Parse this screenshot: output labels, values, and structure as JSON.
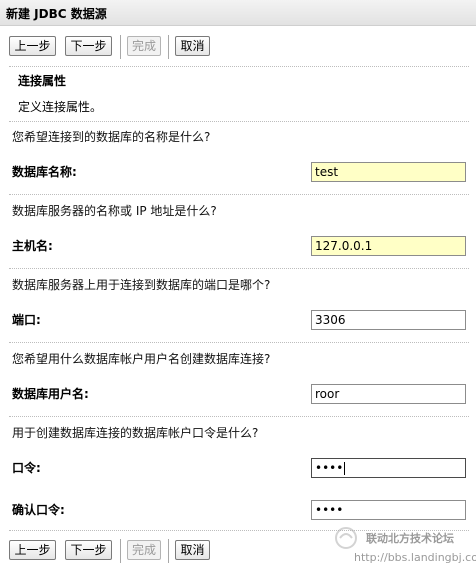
{
  "dialog": {
    "title": "新建 JDBC 数据源"
  },
  "toolbar": {
    "prev_label": "上一步",
    "next_label": "下一步",
    "finish_label": "完成",
    "cancel_label": "取消"
  },
  "section": {
    "heading": "连接属性",
    "description": "定义连接属性。"
  },
  "form": {
    "db_name": {
      "question": "您希望连接到的数据库的名称是什么?",
      "label": "数据库名称:",
      "value": "test"
    },
    "host": {
      "question": "数据库服务器的名称或 IP 地址是什么?",
      "label": "主机名:",
      "value": "127.0.0.1"
    },
    "port": {
      "question": "数据库服务器上用于连接到数据库的端口是哪个?",
      "label": "端口:",
      "value": "3306"
    },
    "db_user": {
      "question": "您希望用什么数据库帐户用户名创建数据库连接?",
      "label": "数据库用户名:",
      "value": "roor"
    },
    "password": {
      "question": "用于创建数据库连接的数据库帐户口令是什么?",
      "label": "口令:",
      "value": "••••"
    },
    "confirm_password": {
      "label": "确认口令:",
      "value": "••••"
    }
  },
  "watermark": {
    "line1": "联动北方技术论坛",
    "line2": "http://bbs.landingbj.com"
  },
  "colors": {
    "required_field_bg": "#ffffc6",
    "title_bar_bg": "#e8e8e8"
  }
}
